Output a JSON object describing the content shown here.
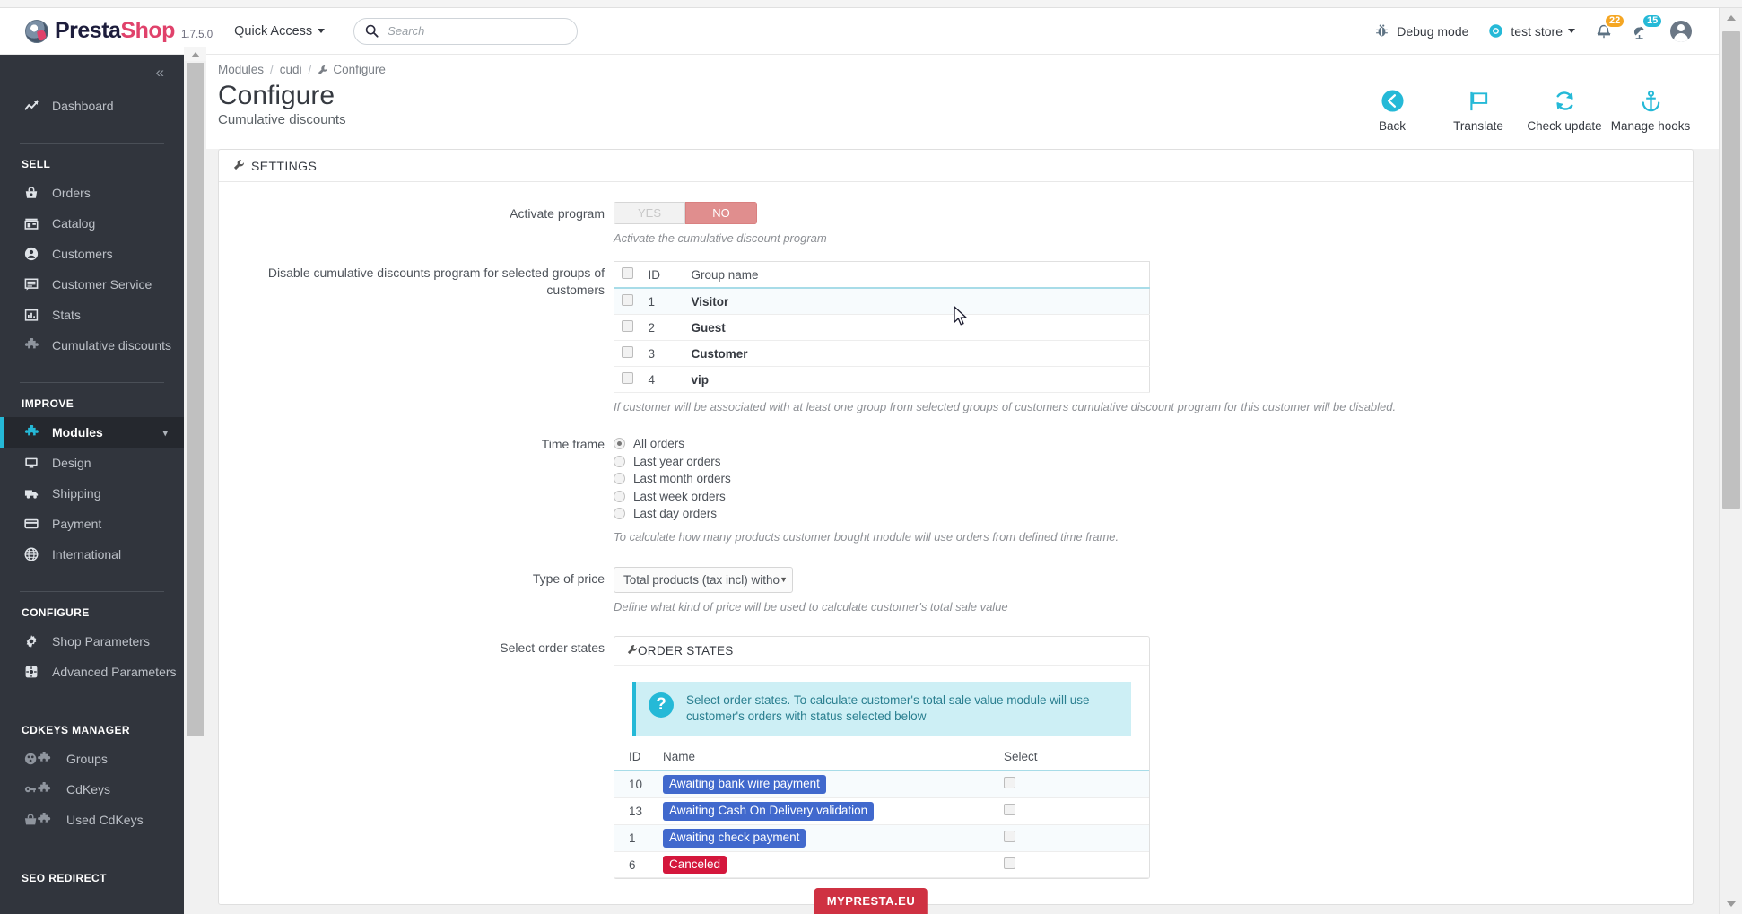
{
  "header": {
    "brand_primary": "Presta",
    "brand_secondary": "Shop",
    "version": "1.7.5.0",
    "quick_access_label": "Quick Access",
    "search_placeholder": "Search",
    "search_value": "",
    "debug_mode_label": "Debug mode",
    "shop_name": "test store",
    "notifications_badge": "22",
    "orders_badge": "15",
    "accent_color": "#25b9d7",
    "brand_pink": "#e0426b"
  },
  "sidebar": {
    "collapse_label": "«",
    "top_items": [
      {
        "label": "Dashboard",
        "icon": "trend-chart-icon"
      }
    ],
    "sections": [
      {
        "title": "SELL",
        "items": [
          {
            "label": "Orders",
            "icon": "shopping-basket-icon"
          },
          {
            "label": "Catalog",
            "icon": "catalog-store-icon"
          },
          {
            "label": "Customers",
            "icon": "customer-avatar-icon"
          },
          {
            "label": "Customer Service",
            "icon": "chat-bubble-icon"
          },
          {
            "label": "Stats",
            "icon": "bar-chart-icon"
          },
          {
            "label": "Cumulative discounts",
            "icon": "puzzle-piece-icon"
          }
        ]
      },
      {
        "title": "IMPROVE",
        "items": [
          {
            "label": "Modules",
            "icon": "puzzle-piece-icon",
            "active": true,
            "has_chevron": true
          },
          {
            "label": "Design",
            "icon": "monitor-icon"
          },
          {
            "label": "Shipping",
            "icon": "truck-icon"
          },
          {
            "label": "Payment",
            "icon": "credit-card-icon"
          },
          {
            "label": "International",
            "icon": "globe-icon"
          }
        ]
      },
      {
        "title": "CONFIGURE",
        "items": [
          {
            "label": "Shop Parameters",
            "icon": "gear-icon"
          },
          {
            "label": "Advanced Parameters",
            "icon": "advanced-gear-icon"
          }
        ]
      },
      {
        "title": "CDKEYS MANAGER",
        "items": [
          {
            "label": "Groups",
            "icon": "groups-puzzle-icon"
          },
          {
            "label": "CdKeys",
            "icon": "key-puzzle-icon"
          },
          {
            "label": "Used CdKeys",
            "icon": "basket-puzzle-icon"
          }
        ]
      },
      {
        "title": "SEO REDIRECT",
        "items": []
      }
    ]
  },
  "page": {
    "breadcrumb": [
      "Modules",
      "cudi"
    ],
    "breadcrumb_current": "Configure",
    "title": "Configure",
    "subtitle": "Cumulative discounts",
    "toolbar": [
      {
        "label": "Back",
        "icon": "arrow-left-circle-icon"
      },
      {
        "label": "Translate",
        "icon": "flag-icon"
      },
      {
        "label": "Check update",
        "icon": "refresh-icon"
      },
      {
        "label": "Manage hooks",
        "icon": "anchor-icon"
      }
    ]
  },
  "settings_panel": {
    "title": "SETTINGS",
    "activate": {
      "label": "Activate program",
      "yes_label": "YES",
      "no_label": "NO",
      "selected": "NO",
      "hint": "Activate the cumulative discount program"
    },
    "groups": {
      "label": "Disable cumulative discounts program for selected groups of customers",
      "columns": [
        "ID",
        "Group name"
      ],
      "rows": [
        {
          "id": "1",
          "name": "Visitor",
          "checked": false
        },
        {
          "id": "2",
          "name": "Guest",
          "checked": false
        },
        {
          "id": "3",
          "name": "Customer",
          "checked": false
        },
        {
          "id": "4",
          "name": "vip",
          "checked": false
        }
      ],
      "hint": "If customer will be associated with at least one group from selected groups of customers cumulative discount program for this customer will be disabled."
    },
    "time_frame": {
      "label": "Time frame",
      "options": [
        {
          "label": "All orders",
          "checked": true
        },
        {
          "label": "Last year orders",
          "checked": false
        },
        {
          "label": "Last month orders",
          "checked": false
        },
        {
          "label": "Last week orders",
          "checked": false
        },
        {
          "label": "Last day orders",
          "checked": false
        }
      ],
      "hint": "To calculate how many products customer bought module will use orders from defined time frame."
    },
    "type_of_price": {
      "label": "Type of price",
      "selected": "Total products (tax incl) witho",
      "hint": "Define what kind of price will be used to calculate customer's total sale value"
    },
    "order_states": {
      "label": "Select order states",
      "panel_title": "ORDER STATES",
      "alert_text": "Select order states. To calculate customer's total sale value module will use customer's orders with status selected below",
      "columns": [
        "ID",
        "Name",
        "Select"
      ],
      "rows": [
        {
          "id": "10",
          "name": "Awaiting bank wire payment",
          "color": "#4169cd",
          "checked": false
        },
        {
          "id": "13",
          "name": "Awaiting Cash On Delivery validation",
          "color": "#4169cd",
          "checked": false
        },
        {
          "id": "1",
          "name": "Awaiting check payment",
          "color": "#4169cd",
          "checked": false
        },
        {
          "id": "6",
          "name": "Canceled",
          "color": "#d4173c",
          "checked": false
        }
      ]
    }
  },
  "footer": {
    "badge": "MYPRESTA.EU"
  }
}
